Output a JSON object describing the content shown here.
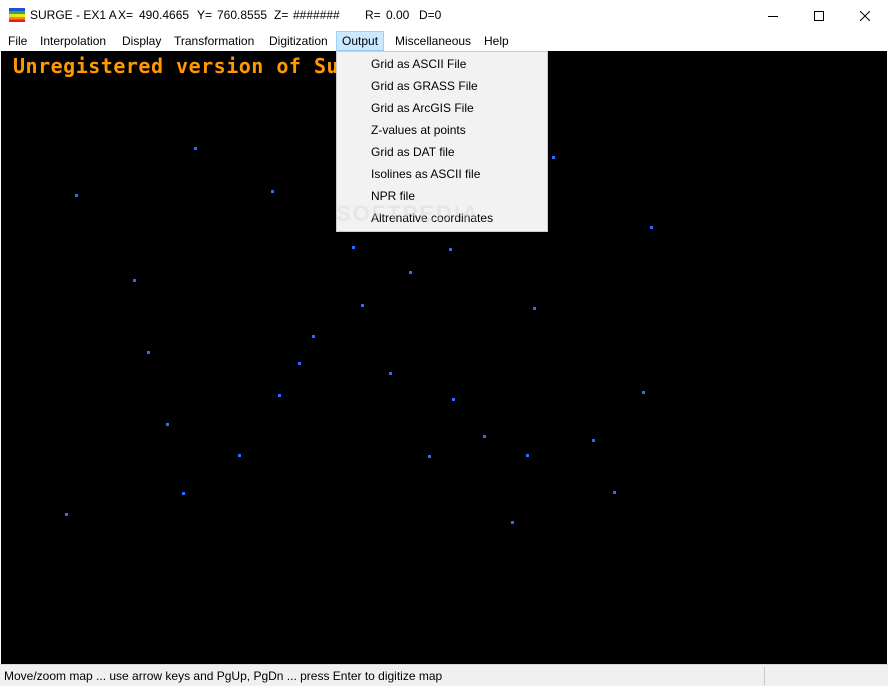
{
  "window": {
    "title": "SURGE - EX1 A",
    "x_label": "X=",
    "x_value": "490.4665",
    "y_label": "Y=",
    "y_value": "760.8555",
    "z_label": "Z=",
    "z_value": "#######",
    "r_label": "R=",
    "r_value": "0.00",
    "d_text": "D=0"
  },
  "menubar": {
    "items": [
      {
        "label": "File"
      },
      {
        "label": "Interpolation"
      },
      {
        "label": "Display"
      },
      {
        "label": "Transformation"
      },
      {
        "label": "Digitization"
      },
      {
        "label": "Output"
      },
      {
        "label": "Miscellaneous"
      },
      {
        "label": "Help"
      }
    ],
    "active": "Output"
  },
  "output_menu": {
    "items": [
      {
        "label": "Grid as ASCII File"
      },
      {
        "label": "Grid as GRASS File"
      },
      {
        "label": "Grid as ArcGIS File"
      },
      {
        "label": "Z-values at points"
      },
      {
        "label": "Grid as DAT file"
      },
      {
        "label": "Isolines as ASCII file"
      },
      {
        "label": "NPR file"
      },
      {
        "label": "Altrenative coordinates"
      }
    ]
  },
  "canvas": {
    "banner": "Unregistered version of Surfer",
    "background": "#000000",
    "banner_color": "#ff9900",
    "point_color": "#2a6cff"
  },
  "watermark": "SOFTPEDIA",
  "statusbar": {
    "text": "Move/zoom map ... use arrow keys and PgUp, PgDn ... press Enter to digitize map"
  }
}
